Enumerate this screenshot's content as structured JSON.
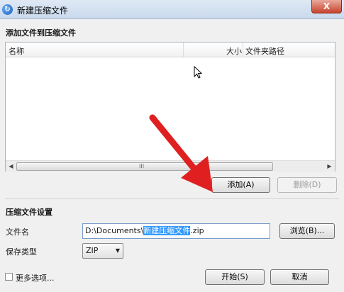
{
  "window": {
    "title": "新建压缩文件",
    "close_glyph": "X",
    "app_icon_glyph": "↻"
  },
  "add_section": {
    "title": "添加文件到压缩文件"
  },
  "file_list": {
    "columns": [
      "名称",
      "大小",
      "文件夹路径"
    ],
    "scroll": {
      "left": "◀",
      "right": "▶",
      "grip": "III"
    }
  },
  "actions": {
    "add_label": "添加(A)",
    "delete_label": "删除(D)"
  },
  "settings": {
    "title": "压缩文件设置",
    "filename_label": "文件名",
    "path_prefix": "D:\\Documents\\",
    "path_selected": "新建压缩文件",
    "path_suffix": ".zip",
    "browse_label": "浏览(B)...",
    "type_label": "保存类型",
    "type_value": "ZIP",
    "type_caret": "▼"
  },
  "footer": {
    "more_options_label": "更多选项...",
    "start_label": "开始(S)",
    "cancel_label": "取消"
  },
  "colors": {
    "annotation_arrow": "#e02020",
    "selection": "#3399ff"
  }
}
